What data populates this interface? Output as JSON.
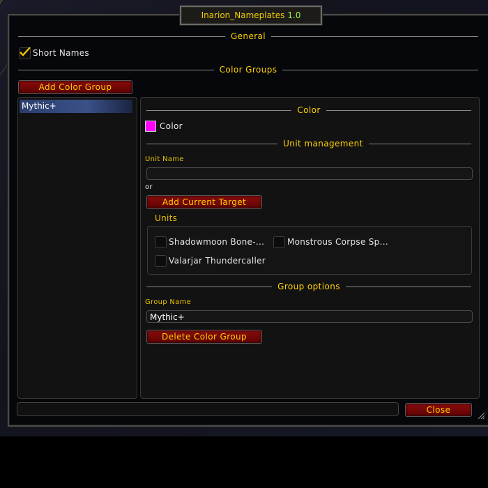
{
  "window": {
    "title": "Inarion_Nameplates",
    "version": "1.0"
  },
  "general": {
    "header": "General",
    "short_names": {
      "label": "Short Names",
      "checked": true
    }
  },
  "color_groups": {
    "header": "Color Groups",
    "add_button": "Add Color Group",
    "items": [
      {
        "label": "Mythic+",
        "selected": true
      }
    ]
  },
  "detail": {
    "color_header": "Color",
    "color_label": "Color",
    "color_value": "#ff00ff",
    "unit_header": "Unit management",
    "unit_name_label": "Unit Name",
    "unit_name_value": "",
    "or_label": "or",
    "add_target_button": "Add Current Target",
    "units_label": "Units",
    "units": [
      {
        "label": "Shadowmoon Bone-...",
        "checked": false
      },
      {
        "label": "Monstrous Corpse Sp...",
        "checked": false
      },
      {
        "label": "Valarjar Thundercaller",
        "checked": false
      }
    ],
    "group_header": "Group options",
    "group_name_label": "Group Name",
    "group_name_value": "Mythic+",
    "delete_button": "Delete Color Group"
  },
  "footer": {
    "status_text": "",
    "close_button": "Close"
  },
  "colors": {
    "accent": "#ffd100",
    "button": "#7a0808",
    "swatch": "#ff00ff"
  }
}
